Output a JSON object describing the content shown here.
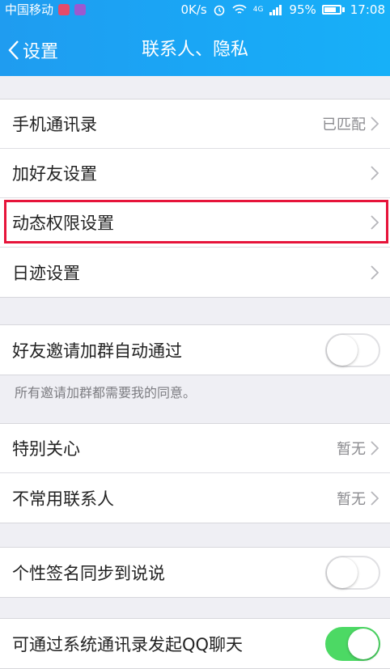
{
  "status_bar": {
    "carrier": "中国移动",
    "speed": "0K/s",
    "network": "4G",
    "battery_percent": "95%",
    "time": "17:08"
  },
  "nav": {
    "back_label": "设置",
    "title": "联系人、隐私"
  },
  "groups": {
    "g1": [
      {
        "label": "手机通讯录",
        "value": "已匹配"
      },
      {
        "label": "加好友设置",
        "value": ""
      },
      {
        "label": "动态权限设置",
        "value": ""
      },
      {
        "label": "日迹设置",
        "value": ""
      }
    ],
    "g2": {
      "label": "好友邀请加群自动通过",
      "toggle": false
    },
    "g2_hint": "所有邀请加群都需要我的同意。",
    "g3": [
      {
        "label": "特别关心",
        "value": "暂无"
      },
      {
        "label": "不常用联系人",
        "value": "暂无"
      }
    ],
    "g4": {
      "label": "个性签名同步到说说",
      "toggle": false
    },
    "g5": {
      "label": "可通过系统通讯录发起QQ聊天",
      "toggle": true
    }
  },
  "colors": {
    "header": "#1aa6f5",
    "toggle_on": "#4cd964",
    "highlight": "#e6143a"
  }
}
